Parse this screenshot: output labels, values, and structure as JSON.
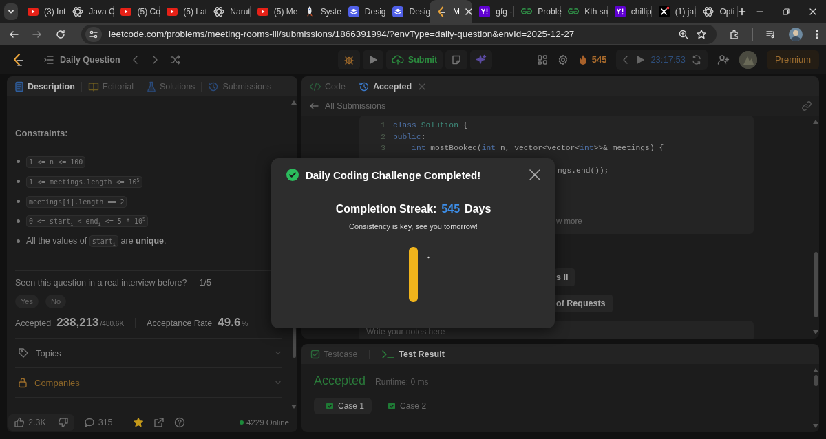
{
  "browser": {
    "tabs": [
      {
        "title": "(3) Int",
        "kind": "video",
        "selected": false
      },
      {
        "title": "Java C",
        "kind": "chat",
        "selected": false
      },
      {
        "title": "(5) Co",
        "kind": "video",
        "selected": false
      },
      {
        "title": "(5) Lat",
        "kind": "video",
        "selected": false
      },
      {
        "title": "Narut",
        "kind": "chat",
        "selected": false
      },
      {
        "title": "(5) Me",
        "kind": "video",
        "selected": false
      },
      {
        "title": "Syste",
        "kind": "rocket",
        "selected": false
      },
      {
        "title": "Desig",
        "kind": "layers",
        "selected": false
      },
      {
        "title": "Desig",
        "kind": "layers",
        "selected": false
      },
      {
        "title": "M",
        "kind": "code",
        "selected": true
      },
      {
        "title": "gfg -",
        "kind": "portal",
        "selected": false
      },
      {
        "title": "Proble",
        "kind": "arcs",
        "selected": false
      },
      {
        "title": "Kth sn",
        "kind": "arcs",
        "selected": false
      },
      {
        "title": "chillip",
        "kind": "portal",
        "selected": false
      },
      {
        "title": "(1) jat",
        "kind": "social",
        "selected": false
      },
      {
        "title": "Opti",
        "kind": "chat",
        "selected": false
      }
    ],
    "url": "leetcode.com/problems/meeting-rooms-iii/submissions/1866391994/?envType=daily-question&envId=2025-12-27"
  },
  "nav": {
    "title": "Daily Question",
    "submit": "Submit",
    "streak": "545",
    "timer": "23:17:53",
    "premium": "Premium"
  },
  "description": {
    "tabs": [
      {
        "label": "Description",
        "kind": "doc",
        "selected": true
      },
      {
        "label": "Editorial",
        "kind": "book",
        "selected": false
      },
      {
        "label": "Solutions",
        "kind": "flask",
        "selected": false
      },
      {
        "label": "Submissions",
        "kind": "history",
        "selected": false
      }
    ],
    "heading": "Constraints:",
    "constraints": [
      {
        "parts": [
          {
            "kind": "code",
            "text": "1 <= n <= 100"
          }
        ]
      },
      {
        "parts": [
          {
            "kind": "code",
            "text": "1 <= meetings.length <= 10$^{5}$"
          }
        ]
      },
      {
        "parts": [
          {
            "kind": "code",
            "text": "meetings[i].length == 2"
          }
        ]
      },
      {
        "parts": [
          {
            "kind": "code",
            "text": "0 <= start$_{i}$ < end$_{i}$ <= 5 * 10$^{5}$"
          }
        ]
      },
      {
        "parts": [
          {
            "kind": "text",
            "text": "All the values of "
          },
          {
            "kind": "code",
            "text": "start$_{i}$"
          },
          {
            "kind": "text",
            "text": " are **unique**."
          }
        ]
      }
    ],
    "interview": {
      "question": "Seen this question in a real interview before?",
      "count": "1/5",
      "options": [
        "Yes",
        "No"
      ]
    },
    "stats": {
      "accepted_label": "Accepted",
      "accepted": "238,213",
      "submissions": "/480.6K",
      "rate_label": "Acceptance Rate",
      "rate": "49.6",
      "rate_unit": "%"
    },
    "sections": [
      {
        "label": "Topics",
        "kind": "topics"
      },
      {
        "label": "Companies",
        "kind": "companies"
      }
    ],
    "footer": {
      "likes": "2.3K",
      "comments": "315",
      "favorite": true,
      "online": "4229 Online"
    }
  },
  "editor": {
    "tabs": [
      {
        "label": "Code",
        "kind": "code",
        "selected": false
      },
      {
        "label": "Accepted",
        "kind": "history",
        "selected": true
      }
    ],
    "back": "All Submissions",
    "code": [
      {
        "line": "1",
        "tokens": [
          {
            "kind": "kw",
            "text": "class "
          },
          {
            "kind": "type",
            "text": "Solution"
          },
          {
            "kind": "plain",
            "text": " {"
          }
        ]
      },
      {
        "line": "2",
        "tokens": [
          {
            "kind": "kw",
            "text": "public"
          },
          {
            "kind": "plain",
            "text": ":"
          }
        ]
      },
      {
        "line": "3",
        "indented": true,
        "tokens": [
          {
            "kind": "kw",
            "text": "int"
          },
          {
            "kind": "plain",
            "text": " mostBooked("
          },
          {
            "kind": "kw",
            "text": "int"
          },
          {
            "kind": "plain",
            "text": " n, vector<vector<"
          },
          {
            "kind": "kw",
            "text": "int"
          },
          {
            "kind": "plain",
            "text": ">>& meetings) {"
          }
        ]
      }
    ],
    "code_tail": "ngs.end());",
    "show_more": "w more",
    "related": [
      "s II",
      "of Requests"
    ],
    "notes_placeholder": "Write your notes here"
  },
  "result": {
    "tabs": [
      {
        "label": "Testcase",
        "kind": "testcase",
        "selected": false
      },
      {
        "label": "Test Result",
        "kind": "terminal",
        "selected": true
      }
    ],
    "status": "Accepted",
    "runtime": "Runtime: 0 ms",
    "cases": [
      {
        "label": "Case 1",
        "selected": true,
        "passed": true
      },
      {
        "label": "Case 2",
        "selected": false,
        "passed": true
      }
    ]
  },
  "modal": {
    "title": "Daily Coding Challenge Completed!",
    "streak_label": "Completion Streak:",
    "streak": "545",
    "streak_unit": "Days",
    "message": "Consistency is key, see you tomorrow!"
  }
}
